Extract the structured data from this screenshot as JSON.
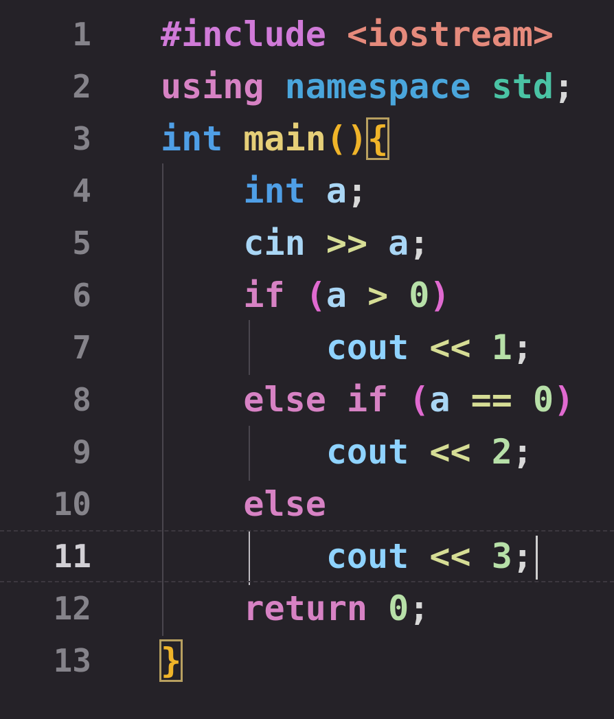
{
  "editor": {
    "lines": [
      {
        "num": "1",
        "tokens": [
          {
            "t": "#include",
            "c": "inc"
          },
          {
            "t": " ",
            "c": "pun"
          },
          {
            "t": "<iostream>",
            "c": "ang"
          }
        ]
      },
      {
        "num": "2",
        "tokens": [
          {
            "t": "using",
            "c": "kw"
          },
          {
            "t": " ",
            "c": "pun"
          },
          {
            "t": "namespace",
            "c": "ns"
          },
          {
            "t": " ",
            "c": "pun"
          },
          {
            "t": "std",
            "c": "std"
          },
          {
            "t": ";",
            "c": "pun"
          }
        ]
      },
      {
        "num": "3",
        "tokens": [
          {
            "t": "int",
            "c": "type"
          },
          {
            "t": " ",
            "c": "pun"
          },
          {
            "t": "main",
            "c": "fn"
          },
          {
            "t": "()",
            "c": "br1"
          },
          {
            "t": "{",
            "c": "br1",
            "box": true
          }
        ]
      },
      {
        "num": "4",
        "tokens": [
          {
            "t": "    ",
            "c": "pun"
          },
          {
            "t": "int",
            "c": "type"
          },
          {
            "t": " ",
            "c": "pun"
          },
          {
            "t": "a",
            "c": "var"
          },
          {
            "t": ";",
            "c": "pun"
          }
        ]
      },
      {
        "num": "5",
        "tokens": [
          {
            "t": "    ",
            "c": "pun"
          },
          {
            "t": "cin",
            "c": "var"
          },
          {
            "t": " ",
            "c": "pun"
          },
          {
            "t": ">>",
            "c": "op"
          },
          {
            "t": " ",
            "c": "pun"
          },
          {
            "t": "a",
            "c": "var"
          },
          {
            "t": ";",
            "c": "pun"
          }
        ]
      },
      {
        "num": "6",
        "tokens": [
          {
            "t": "    ",
            "c": "pun"
          },
          {
            "t": "if",
            "c": "kw"
          },
          {
            "t": " ",
            "c": "pun"
          },
          {
            "t": "(",
            "c": "br2"
          },
          {
            "t": "a",
            "c": "var"
          },
          {
            "t": " ",
            "c": "pun"
          },
          {
            "t": ">",
            "c": "op"
          },
          {
            "t": " ",
            "c": "pun"
          },
          {
            "t": "0",
            "c": "num"
          },
          {
            "t": ")",
            "c": "br2"
          }
        ]
      },
      {
        "num": "7",
        "tokens": [
          {
            "t": "        ",
            "c": "pun"
          },
          {
            "t": "cout",
            "c": "id"
          },
          {
            "t": " ",
            "c": "pun"
          },
          {
            "t": "<<",
            "c": "op"
          },
          {
            "t": " ",
            "c": "pun"
          },
          {
            "t": "1",
            "c": "num"
          },
          {
            "t": ";",
            "c": "pun"
          }
        ]
      },
      {
        "num": "8",
        "tokens": [
          {
            "t": "    ",
            "c": "pun"
          },
          {
            "t": "else",
            "c": "kw"
          },
          {
            "t": " ",
            "c": "pun"
          },
          {
            "t": "if",
            "c": "kw"
          },
          {
            "t": " ",
            "c": "pun"
          },
          {
            "t": "(",
            "c": "br2"
          },
          {
            "t": "a",
            "c": "var"
          },
          {
            "t": " ",
            "c": "pun"
          },
          {
            "t": "==",
            "c": "op"
          },
          {
            "t": " ",
            "c": "pun"
          },
          {
            "t": "0",
            "c": "num"
          },
          {
            "t": ")",
            "c": "br2"
          }
        ]
      },
      {
        "num": "9",
        "tokens": [
          {
            "t": "        ",
            "c": "pun"
          },
          {
            "t": "cout",
            "c": "id"
          },
          {
            "t": " ",
            "c": "pun"
          },
          {
            "t": "<<",
            "c": "op"
          },
          {
            "t": " ",
            "c": "pun"
          },
          {
            "t": "2",
            "c": "num"
          },
          {
            "t": ";",
            "c": "pun"
          }
        ]
      },
      {
        "num": "10",
        "tokens": [
          {
            "t": "    ",
            "c": "pun"
          },
          {
            "t": "else",
            "c": "kw"
          }
        ]
      },
      {
        "num": "11",
        "active": true,
        "tokens": [
          {
            "t": "        ",
            "c": "pun"
          },
          {
            "t": "cout",
            "c": "id"
          },
          {
            "t": " ",
            "c": "pun"
          },
          {
            "t": "<<",
            "c": "op"
          },
          {
            "t": " ",
            "c": "pun"
          },
          {
            "t": "3",
            "c": "num"
          },
          {
            "t": ";",
            "c": "pun"
          }
        ]
      },
      {
        "num": "12",
        "tokens": [
          {
            "t": "    ",
            "c": "pun"
          },
          {
            "t": "return",
            "c": "kw"
          },
          {
            "t": " ",
            "c": "pun"
          },
          {
            "t": "0",
            "c": "num"
          },
          {
            "t": ";",
            "c": "pun"
          }
        ]
      },
      {
        "num": "13",
        "tokens": [
          {
            "t": "}",
            "c": "br1",
            "box": true
          }
        ]
      }
    ]
  },
  "colors": {
    "background": "#252228",
    "line_number": "#85838a",
    "active_line_number": "#d2d0d5"
  }
}
